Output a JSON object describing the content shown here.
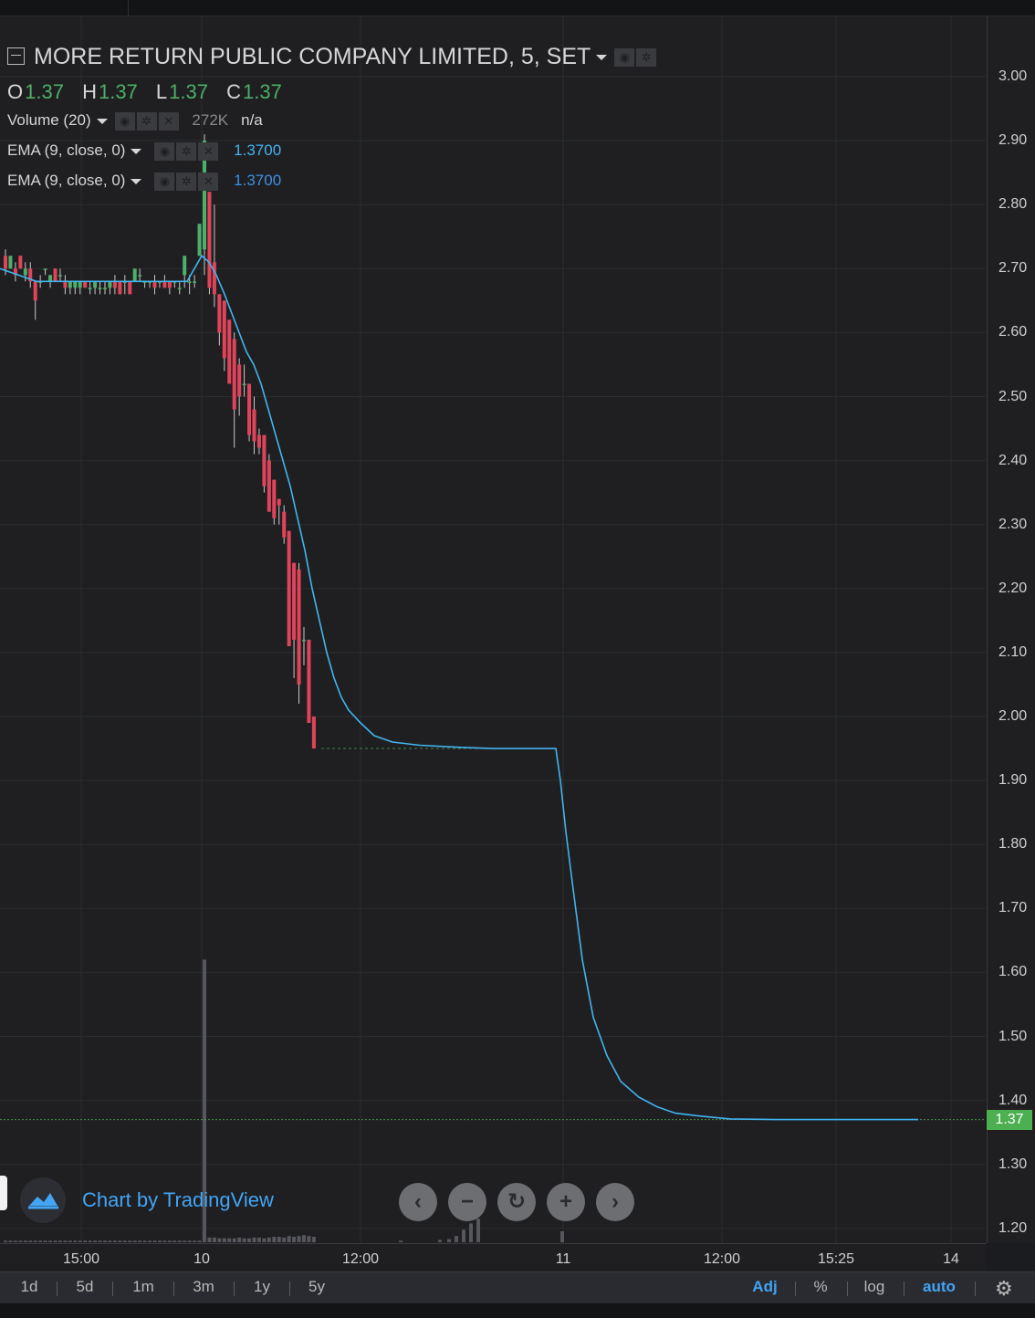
{
  "header": {
    "symbol_title": "MORE RETURN PUBLIC COMPANY LIMITED, 5, SET",
    "ohlc": {
      "o_label": "O",
      "o": "1.37",
      "h_label": "H",
      "h": "1.37",
      "l_label": "L",
      "l": "1.37",
      "c_label": "C",
      "c": "1.37"
    }
  },
  "indicators": {
    "volume": {
      "label": "Volume (20)",
      "value": "272K",
      "extra": "n/a"
    },
    "ema1": {
      "label": "EMA (9, close, 0)",
      "value": "1.3700"
    },
    "ema2": {
      "label": "EMA (9, close, 0)",
      "value": "1.3700"
    }
  },
  "last_price_tag": "1.37",
  "watermark": {
    "text": "Chart by TradingView"
  },
  "nav_buttons": {
    "back": "‹",
    "zoom_out": "−",
    "reset": "↻",
    "zoom_in": "+",
    "forward": "›"
  },
  "bottom_bar": {
    "ranges": [
      "1d",
      "5d",
      "1m",
      "3m",
      "1y",
      "5y"
    ],
    "options": [
      "Adj",
      "%",
      "log",
      "auto"
    ]
  },
  "colors": {
    "up": "#4caf6a",
    "down": "#e0445a",
    "ema": "#42b4ef",
    "volume": "#55575c",
    "last_price": "#4caf50",
    "background": "#1f1f21"
  },
  "chart_data": {
    "type": "candlestick",
    "title": "MORE RETURN PUBLIC COMPANY LIMITED, 5, SET",
    "y_ticks": [
      "1.20",
      "1.30",
      "1.40",
      "1.50",
      "1.60",
      "1.70",
      "1.80",
      "1.90",
      "2.00",
      "2.10",
      "2.20",
      "2.30",
      "2.40",
      "2.50",
      "2.60",
      "2.70",
      "2.80",
      "2.90",
      "3.00"
    ],
    "x_ticks": [
      "15:00",
      "10",
      "12:00",
      "11",
      "12:00",
      "15:25",
      "14"
    ],
    "ylim": [
      1.155,
      3.06
    ],
    "grid": true,
    "candles": [
      [
        2.72,
        2.73,
        2.69,
        2.7
      ],
      [
        2.7,
        2.72,
        2.7,
        2.72
      ],
      [
        2.7,
        2.71,
        2.68,
        2.69
      ],
      [
        2.72,
        2.72,
        2.7,
        2.7
      ],
      [
        2.69,
        2.71,
        2.68,
        2.7
      ],
      [
        2.7,
        2.71,
        2.67,
        2.68
      ],
      [
        2.68,
        2.68,
        2.62,
        2.65
      ],
      [
        2.68,
        2.69,
        2.67,
        2.68
      ],
      [
        2.7,
        2.7,
        2.69,
        2.7
      ],
      [
        2.68,
        2.69,
        2.67,
        2.69
      ],
      [
        2.7,
        2.7,
        2.68,
        2.68
      ],
      [
        2.69,
        2.7,
        2.68,
        2.69
      ],
      [
        2.68,
        2.69,
        2.66,
        2.67
      ],
      [
        2.67,
        2.68,
        2.66,
        2.68
      ],
      [
        2.67,
        2.68,
        2.66,
        2.68
      ],
      [
        2.67,
        2.68,
        2.66,
        2.68
      ],
      [
        2.68,
        2.68,
        2.67,
        2.67
      ],
      [
        2.67,
        2.68,
        2.66,
        2.67
      ],
      [
        2.67,
        2.68,
        2.66,
        2.68
      ],
      [
        2.67,
        2.68,
        2.66,
        2.67
      ],
      [
        2.67,
        2.68,
        2.66,
        2.67
      ],
      [
        2.67,
        2.68,
        2.66,
        2.68
      ],
      [
        2.68,
        2.69,
        2.66,
        2.67
      ],
      [
        2.68,
        2.68,
        2.66,
        2.66
      ],
      [
        2.68,
        2.69,
        2.66,
        2.68
      ],
      [
        2.68,
        2.68,
        2.66,
        2.66
      ],
      [
        2.68,
        2.7,
        2.68,
        2.7
      ],
      [
        2.69,
        2.7,
        2.68,
        2.69
      ],
      [
        2.68,
        2.68,
        2.67,
        2.68
      ],
      [
        2.68,
        2.68,
        2.67,
        2.68
      ],
      [
        2.68,
        2.69,
        2.66,
        2.67
      ],
      [
        2.68,
        2.68,
        2.67,
        2.68
      ],
      [
        2.68,
        2.69,
        2.67,
        2.67
      ],
      [
        2.68,
        2.68,
        2.66,
        2.67
      ],
      [
        2.68,
        2.68,
        2.67,
        2.68
      ],
      [
        2.67,
        2.68,
        2.66,
        2.67
      ],
      [
        2.69,
        2.72,
        2.67,
        2.72
      ],
      [
        2.68,
        2.69,
        2.66,
        2.68
      ],
      [
        2.68,
        2.69,
        2.67,
        2.68
      ],
      [
        2.72,
        2.77,
        2.72,
        2.77
      ],
      [
        2.73,
        2.91,
        2.69,
        2.9
      ],
      [
        2.82,
        2.82,
        2.66,
        2.67
      ],
      [
        2.71,
        2.8,
        2.64,
        2.66
      ],
      [
        2.66,
        2.66,
        2.58,
        2.6
      ],
      [
        2.65,
        2.65,
        2.54,
        2.56
      ],
      [
        2.62,
        2.62,
        2.52,
        2.52
      ],
      [
        2.59,
        2.6,
        2.42,
        2.48
      ],
      [
        2.55,
        2.56,
        2.47,
        2.5
      ],
      [
        2.52,
        2.55,
        2.5,
        2.52
      ],
      [
        2.52,
        2.52,
        2.43,
        2.44
      ],
      [
        2.48,
        2.5,
        2.41,
        2.43
      ],
      [
        2.44,
        2.45,
        2.41,
        2.42
      ],
      [
        2.44,
        2.44,
        2.35,
        2.36
      ],
      [
        2.4,
        2.41,
        2.32,
        2.32
      ],
      [
        2.37,
        2.37,
        2.3,
        2.31
      ],
      [
        2.34,
        2.34,
        2.3,
        2.33
      ],
      [
        2.32,
        2.33,
        2.27,
        2.28
      ],
      [
        2.29,
        2.29,
        2.11,
        2.11
      ],
      [
        2.24,
        2.24,
        2.06,
        2.12
      ],
      [
        2.23,
        2.24,
        2.02,
        2.05
      ],
      [
        2.12,
        2.14,
        2.08,
        2.12
      ],
      [
        2.12,
        2.12,
        1.99,
        1.99
      ],
      [
        2.0,
        2.0,
        1.95,
        1.95
      ]
    ],
    "ema_series": [
      [
        0,
        2.7
      ],
      [
        40,
        2.68
      ],
      [
        60,
        2.68
      ],
      [
        100,
        2.68
      ],
      [
        155,
        2.68
      ],
      [
        180,
        2.68
      ],
      [
        205,
        2.68
      ],
      [
        213,
        2.7
      ],
      [
        221,
        2.72
      ],
      [
        229,
        2.71
      ],
      [
        237,
        2.69
      ],
      [
        246,
        2.66
      ],
      [
        254,
        2.63
      ],
      [
        262,
        2.6
      ],
      [
        270,
        2.57
      ],
      [
        278,
        2.55
      ],
      [
        286,
        2.52
      ],
      [
        294,
        2.48
      ],
      [
        302,
        2.44
      ],
      [
        310,
        2.4
      ],
      [
        318,
        2.36
      ],
      [
        326,
        2.31
      ],
      [
        334,
        2.26
      ],
      [
        342,
        2.2
      ],
      [
        350,
        2.15
      ],
      [
        358,
        2.1
      ],
      [
        366,
        2.06
      ],
      [
        374,
        2.03
      ],
      [
        382,
        2.01
      ],
      [
        395,
        1.99
      ],
      [
        410,
        1.97
      ],
      [
        430,
        1.96
      ],
      [
        460,
        1.955
      ],
      [
        500,
        1.952
      ],
      [
        540,
        1.95
      ],
      [
        575,
        1.95
      ],
      [
        609,
        1.95
      ],
      [
        614,
        1.9
      ],
      [
        620,
        1.82
      ],
      [
        628,
        1.73
      ],
      [
        638,
        1.62
      ],
      [
        650,
        1.53
      ],
      [
        665,
        1.47
      ],
      [
        680,
        1.43
      ],
      [
        700,
        1.405
      ],
      [
        720,
        1.39
      ],
      [
        740,
        1.38
      ],
      [
        770,
        1.375
      ],
      [
        800,
        1.371
      ],
      [
        850,
        1.37
      ],
      [
        1006,
        1.37
      ]
    ],
    "volume": [
      2,
      2,
      2,
      2,
      2,
      2,
      2,
      2,
      2,
      2,
      2,
      2,
      2,
      2,
      2,
      2,
      2,
      2,
      2,
      2,
      2,
      2,
      2,
      2,
      2,
      2,
      2,
      2,
      2,
      2,
      2,
      2,
      2,
      2,
      2,
      2,
      2,
      2,
      2,
      2,
      360,
      6,
      6,
      5,
      5,
      5,
      5,
      6,
      5,
      5,
      6,
      6,
      5,
      6,
      7,
      7,
      6,
      8,
      7,
      8,
      9,
      8,
      7
    ]
  }
}
